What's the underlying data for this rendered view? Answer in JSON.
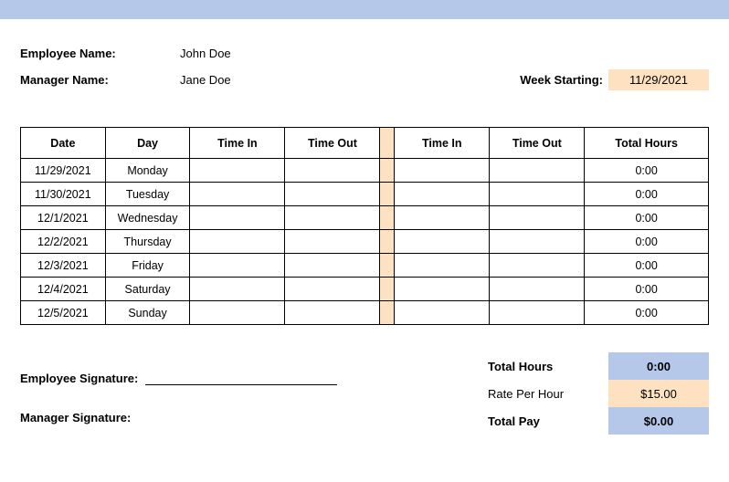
{
  "header": {
    "employee_name_label": "Employee Name:",
    "employee_name": "John Doe",
    "manager_name_label": "Manager Name:",
    "manager_name": "Jane Doe",
    "week_starting_label": "Week Starting:",
    "week_starting": "11/29/2021"
  },
  "table": {
    "cols": {
      "date": "Date",
      "day": "Day",
      "time_in_1": "Time In",
      "time_out_1": "Time Out",
      "time_in_2": "Time In",
      "time_out_2": "Time Out",
      "total_hours": "Total Hours"
    },
    "rows": [
      {
        "date": "11/29/2021",
        "day": "Monday",
        "in1": "",
        "out1": "",
        "in2": "",
        "out2": "",
        "total": "0:00"
      },
      {
        "date": "11/30/2021",
        "day": "Tuesday",
        "in1": "",
        "out1": "",
        "in2": "",
        "out2": "",
        "total": "0:00"
      },
      {
        "date": "12/1/2021",
        "day": "Wednesday",
        "in1": "",
        "out1": "",
        "in2": "",
        "out2": "",
        "total": "0:00"
      },
      {
        "date": "12/2/2021",
        "day": "Thursday",
        "in1": "",
        "out1": "",
        "in2": "",
        "out2": "",
        "total": "0:00"
      },
      {
        "date": "12/3/2021",
        "day": "Friday",
        "in1": "",
        "out1": "",
        "in2": "",
        "out2": "",
        "total": "0:00"
      },
      {
        "date": "12/4/2021",
        "day": "Saturday",
        "in1": "",
        "out1": "",
        "in2": "",
        "out2": "",
        "total": "0:00"
      },
      {
        "date": "12/5/2021",
        "day": "Sunday",
        "in1": "",
        "out1": "",
        "in2": "",
        "out2": "",
        "total": "0:00"
      }
    ]
  },
  "totals": {
    "total_hours_label": "Total Hours",
    "total_hours": "0:00",
    "rate_label": "Rate Per Hour",
    "rate": "$15.00",
    "total_pay_label": "Total Pay",
    "total_pay": "$0.00"
  },
  "sig": {
    "employee_label": "Employee Signature:",
    "manager_label": "Manager Signature:"
  }
}
